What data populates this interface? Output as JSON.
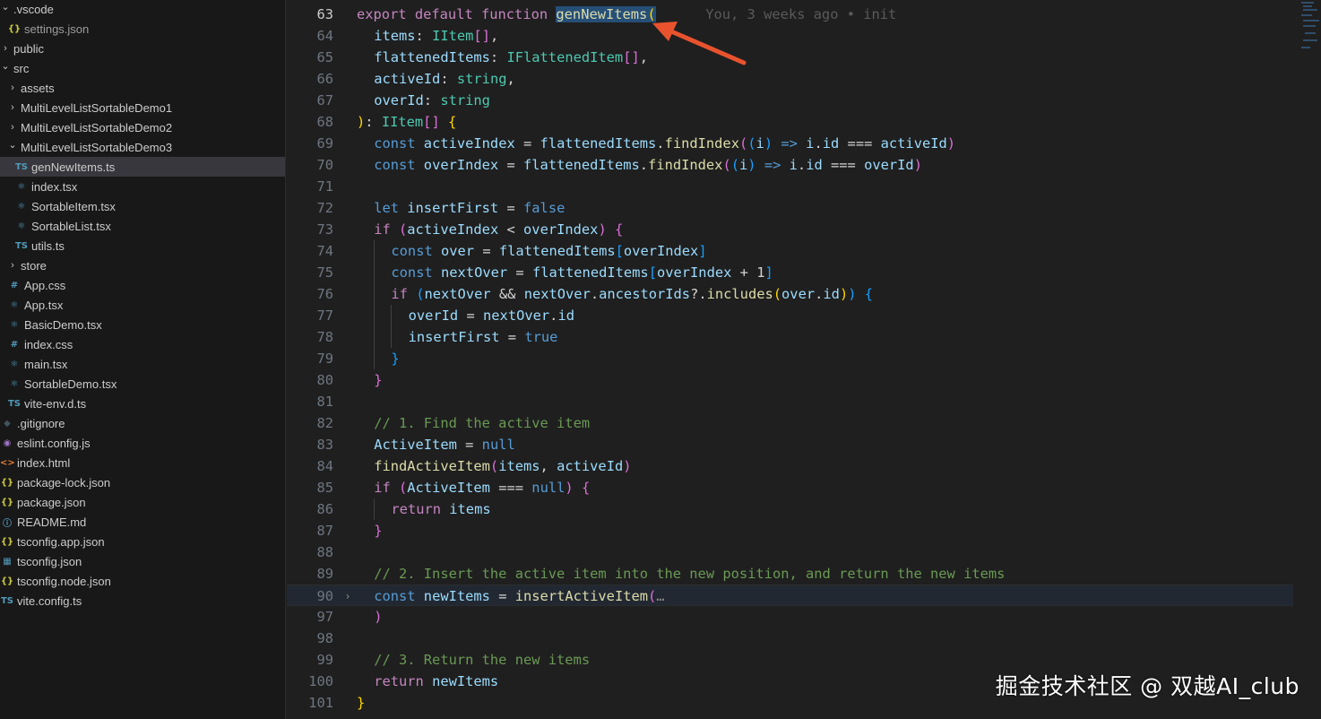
{
  "explorer": {
    "items": [
      {
        "label": ".vscode",
        "depth": 0,
        "chevron": "down",
        "icon": "none"
      },
      {
        "label": "settings.json",
        "depth": 1,
        "icon": "json",
        "dim": true
      },
      {
        "label": "public",
        "depth": 0,
        "chevron": "right",
        "icon": "none"
      },
      {
        "label": "src",
        "depth": 0,
        "chevron": "down",
        "icon": "none"
      },
      {
        "label": "assets",
        "depth": 1,
        "chevron": "right",
        "icon": "none"
      },
      {
        "label": "MultiLevelListSortableDemo1",
        "depth": 1,
        "chevron": "right",
        "icon": "none"
      },
      {
        "label": "MultiLevelListSortableDemo2",
        "depth": 1,
        "chevron": "right",
        "icon": "none"
      },
      {
        "label": "MultiLevelListSortableDemo3",
        "depth": 1,
        "chevron": "down",
        "icon": "none"
      },
      {
        "label": "genNewItems.ts",
        "depth": 2,
        "icon": "ts",
        "selected": true
      },
      {
        "label": "index.tsx",
        "depth": 2,
        "icon": "react"
      },
      {
        "label": "SortableItem.tsx",
        "depth": 2,
        "icon": "react"
      },
      {
        "label": "SortableList.tsx",
        "depth": 2,
        "icon": "react"
      },
      {
        "label": "utils.ts",
        "depth": 2,
        "icon": "ts"
      },
      {
        "label": "store",
        "depth": 1,
        "chevron": "right",
        "icon": "none"
      },
      {
        "label": "App.css",
        "depth": 1,
        "icon": "css"
      },
      {
        "label": "App.tsx",
        "depth": 1,
        "icon": "react"
      },
      {
        "label": "BasicDemo.tsx",
        "depth": 1,
        "icon": "react"
      },
      {
        "label": "index.css",
        "depth": 1,
        "icon": "css"
      },
      {
        "label": "main.tsx",
        "depth": 1,
        "icon": "react"
      },
      {
        "label": "SortableDemo.tsx",
        "depth": 1,
        "icon": "react"
      },
      {
        "label": "vite-env.d.ts",
        "depth": 1,
        "icon": "ts"
      },
      {
        "label": ".gitignore",
        "depth": 0,
        "icon": "git"
      },
      {
        "label": "eslint.config.js",
        "depth": 0,
        "icon": "eslint"
      },
      {
        "label": "index.html",
        "depth": 0,
        "icon": "html"
      },
      {
        "label": "package-lock.json",
        "depth": 0,
        "icon": "json"
      },
      {
        "label": "package.json",
        "depth": 0,
        "icon": "json"
      },
      {
        "label": "README.md",
        "depth": 0,
        "icon": "info"
      },
      {
        "label": "tsconfig.app.json",
        "depth": 0,
        "icon": "json"
      },
      {
        "label": "tsconfig.json",
        "depth": 0,
        "icon": "tsconfig"
      },
      {
        "label": "tsconfig.node.json",
        "depth": 0,
        "icon": "json"
      },
      {
        "label": "vite.config.ts",
        "depth": 0,
        "icon": "ts"
      }
    ]
  },
  "editor": {
    "current_line": "90",
    "lines": [
      {
        "num": "63",
        "indent": 0,
        "tokens": [
          [
            "export default function ",
            "kc"
          ],
          [
            "genNewItems",
            "fn hl"
          ],
          [
            "(",
            "br1 hl"
          ],
          [
            "      You, 3 weeks ago • init",
            "blame"
          ]
        ]
      },
      {
        "num": "64",
        "indent": 1,
        "tokens": [
          [
            "items",
            "vr"
          ],
          [
            ": ",
            "op"
          ],
          [
            "IItem",
            "ty"
          ],
          [
            "[]",
            "br2"
          ],
          [
            ",",
            "op"
          ]
        ]
      },
      {
        "num": "65",
        "indent": 1,
        "tokens": [
          [
            "flattenedItems",
            "vr"
          ],
          [
            ": ",
            "op"
          ],
          [
            "IFlattenedItem",
            "ty"
          ],
          [
            "[]",
            "br2"
          ],
          [
            ",",
            "op"
          ]
        ]
      },
      {
        "num": "66",
        "indent": 1,
        "tokens": [
          [
            "activeId",
            "vr"
          ],
          [
            ": ",
            "op"
          ],
          [
            "string",
            "ty"
          ],
          [
            ",",
            "op"
          ]
        ]
      },
      {
        "num": "67",
        "indent": 1,
        "tokens": [
          [
            "overId",
            "vr"
          ],
          [
            ": ",
            "op"
          ],
          [
            "string",
            "ty"
          ]
        ]
      },
      {
        "num": "68",
        "indent": 0,
        "tokens": [
          [
            ")",
            "br1"
          ],
          [
            ": ",
            "op"
          ],
          [
            "IItem",
            "ty"
          ],
          [
            "[]",
            "br2"
          ],
          [
            " ",
            "op"
          ],
          [
            "{",
            "br1"
          ]
        ]
      },
      {
        "num": "69",
        "indent": 1,
        "tokens": [
          [
            "const ",
            "kw"
          ],
          [
            "activeIndex",
            "vr"
          ],
          [
            " = ",
            "op"
          ],
          [
            "flattenedItems",
            "vr"
          ],
          [
            ".",
            "op"
          ],
          [
            "findIndex",
            "fn"
          ],
          [
            "(",
            "br2"
          ],
          [
            "(",
            "br3"
          ],
          [
            "i",
            "vr"
          ],
          [
            ")",
            "br3"
          ],
          [
            " => ",
            "kw"
          ],
          [
            "i",
            "vr"
          ],
          [
            ".",
            "op"
          ],
          [
            "id",
            "vr"
          ],
          [
            " === ",
            "op"
          ],
          [
            "activeId",
            "vr"
          ],
          [
            ")",
            "br2"
          ]
        ]
      },
      {
        "num": "70",
        "indent": 1,
        "tokens": [
          [
            "const ",
            "kw"
          ],
          [
            "overIndex",
            "vr"
          ],
          [
            " = ",
            "op"
          ],
          [
            "flattenedItems",
            "vr"
          ],
          [
            ".",
            "op"
          ],
          [
            "findIndex",
            "fn"
          ],
          [
            "(",
            "br2"
          ],
          [
            "(",
            "br3"
          ],
          [
            "i",
            "vr"
          ],
          [
            ")",
            "br3"
          ],
          [
            " => ",
            "kw"
          ],
          [
            "i",
            "vr"
          ],
          [
            ".",
            "op"
          ],
          [
            "id",
            "vr"
          ],
          [
            " === ",
            "op"
          ],
          [
            "overId",
            "vr"
          ],
          [
            ")",
            "br2"
          ]
        ]
      },
      {
        "num": "71",
        "indent": 1,
        "tokens": []
      },
      {
        "num": "72",
        "indent": 1,
        "tokens": [
          [
            "let ",
            "kw"
          ],
          [
            "insertFirst",
            "vr"
          ],
          [
            " = ",
            "op"
          ],
          [
            "false",
            "kw"
          ]
        ]
      },
      {
        "num": "73",
        "indent": 1,
        "tokens": [
          [
            "if ",
            "kc"
          ],
          [
            "(",
            "br2"
          ],
          [
            "activeIndex",
            "vr"
          ],
          [
            " < ",
            "op"
          ],
          [
            "overIndex",
            "vr"
          ],
          [
            ")",
            "br2"
          ],
          [
            " ",
            "op"
          ],
          [
            "{",
            "br2"
          ]
        ]
      },
      {
        "num": "74",
        "indent": 2,
        "tokens": [
          [
            "const ",
            "kw"
          ],
          [
            "over",
            "vr"
          ],
          [
            " = ",
            "op"
          ],
          [
            "flattenedItems",
            "vr"
          ],
          [
            "[",
            "br3"
          ],
          [
            "overIndex",
            "vr"
          ],
          [
            "]",
            "br3"
          ]
        ]
      },
      {
        "num": "75",
        "indent": 2,
        "tokens": [
          [
            "const ",
            "kw"
          ],
          [
            "nextOver",
            "vr"
          ],
          [
            " = ",
            "op"
          ],
          [
            "flattenedItems",
            "vr"
          ],
          [
            "[",
            "br3"
          ],
          [
            "overIndex",
            "vr"
          ],
          [
            " + ",
            "op"
          ],
          [
            "1",
            "op"
          ],
          [
            "]",
            "br3"
          ]
        ]
      },
      {
        "num": "76",
        "indent": 2,
        "tokens": [
          [
            "if ",
            "kc"
          ],
          [
            "(",
            "br3"
          ],
          [
            "nextOver",
            "vr"
          ],
          [
            " && ",
            "op"
          ],
          [
            "nextOver",
            "vr"
          ],
          [
            ".",
            "op"
          ],
          [
            "ancestorIds",
            "vr"
          ],
          [
            "?.",
            "op"
          ],
          [
            "includes",
            "fn"
          ],
          [
            "(",
            "br1"
          ],
          [
            "over",
            "vr"
          ],
          [
            ".",
            "op"
          ],
          [
            "id",
            "vr"
          ],
          [
            ")",
            "br1"
          ],
          [
            ")",
            "br3"
          ],
          [
            " ",
            "op"
          ],
          [
            "{",
            "br3"
          ]
        ]
      },
      {
        "num": "77",
        "indent": 3,
        "tokens": [
          [
            "overId",
            "vr"
          ],
          [
            " = ",
            "op"
          ],
          [
            "nextOver",
            "vr"
          ],
          [
            ".",
            "op"
          ],
          [
            "id",
            "vr"
          ]
        ]
      },
      {
        "num": "78",
        "indent": 3,
        "tokens": [
          [
            "insertFirst",
            "vr"
          ],
          [
            " = ",
            "op"
          ],
          [
            "true",
            "kw"
          ]
        ]
      },
      {
        "num": "79",
        "indent": 2,
        "tokens": [
          [
            "}",
            "br3"
          ]
        ]
      },
      {
        "num": "80",
        "indent": 1,
        "tokens": [
          [
            "}",
            "br2"
          ]
        ]
      },
      {
        "num": "81",
        "indent": 1,
        "tokens": []
      },
      {
        "num": "82",
        "indent": 1,
        "tokens": [
          [
            "// 1. Find the active item",
            "cm"
          ]
        ]
      },
      {
        "num": "83",
        "indent": 1,
        "tokens": [
          [
            "ActiveItem",
            "vr"
          ],
          [
            " = ",
            "op"
          ],
          [
            "null",
            "kw"
          ]
        ]
      },
      {
        "num": "84",
        "indent": 1,
        "tokens": [
          [
            "findActiveItem",
            "fn"
          ],
          [
            "(",
            "br2"
          ],
          [
            "items",
            "vr"
          ],
          [
            ", ",
            "op"
          ],
          [
            "activeId",
            "vr"
          ],
          [
            ")",
            "br2"
          ]
        ]
      },
      {
        "num": "85",
        "indent": 1,
        "tokens": [
          [
            "if ",
            "kc"
          ],
          [
            "(",
            "br2"
          ],
          [
            "ActiveItem",
            "vr"
          ],
          [
            " === ",
            "op"
          ],
          [
            "null",
            "kw"
          ],
          [
            ")",
            "br2"
          ],
          [
            " ",
            "op"
          ],
          [
            "{",
            "br2"
          ]
        ]
      },
      {
        "num": "86",
        "indent": 2,
        "tokens": [
          [
            "return ",
            "kc"
          ],
          [
            "items",
            "vr"
          ]
        ]
      },
      {
        "num": "87",
        "indent": 1,
        "tokens": [
          [
            "}",
            "br2"
          ]
        ]
      },
      {
        "num": "88",
        "indent": 1,
        "tokens": []
      },
      {
        "num": "89",
        "indent": 1,
        "tokens": [
          [
            "// 2. Insert the active item into the new position, and return the new items",
            "cm"
          ]
        ]
      },
      {
        "num": "90",
        "indent": 1,
        "fold": "›",
        "tokens": [
          [
            "const ",
            "kw"
          ],
          [
            "newItems",
            "vr"
          ],
          [
            " = ",
            "op"
          ],
          [
            "insertActiveItem",
            "fn"
          ],
          [
            "(",
            "br2"
          ],
          [
            "…",
            "ell"
          ]
        ]
      },
      {
        "num": "97",
        "indent": 1,
        "tokens": [
          [
            ")",
            "br2"
          ]
        ]
      },
      {
        "num": "98",
        "indent": 1,
        "tokens": []
      },
      {
        "num": "99",
        "indent": 1,
        "tokens": [
          [
            "// 3. Return the new items",
            "cm"
          ]
        ]
      },
      {
        "num": "100",
        "indent": 1,
        "tokens": [
          [
            "return ",
            "kc"
          ],
          [
            "newItems",
            "vr"
          ]
        ]
      },
      {
        "num": "101",
        "indent": 0,
        "tokens": [
          [
            "}",
            "br1"
          ]
        ]
      }
    ]
  },
  "watermark": "掘金技术社区 @ 双越AI_club",
  "colors": {
    "arrow": "#e8532e",
    "selection": "#264f78",
    "sidebar_bg": "#181818",
    "editor_bg": "#1f1f1f"
  }
}
